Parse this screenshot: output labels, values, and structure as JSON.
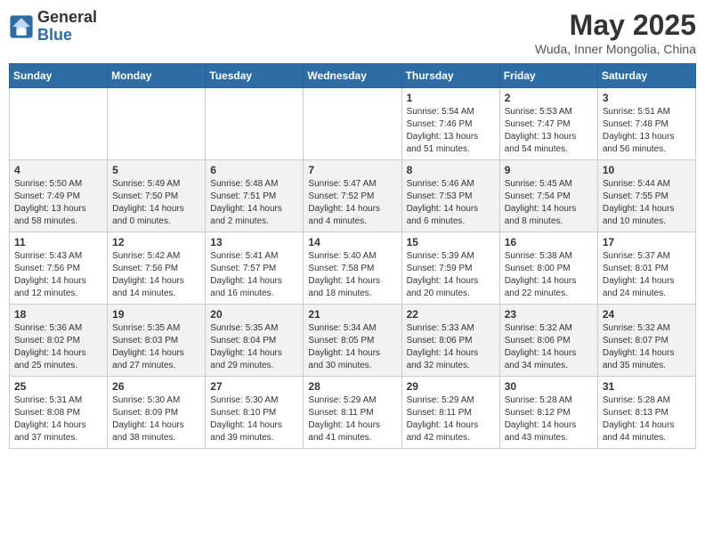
{
  "logo": {
    "general": "General",
    "blue": "Blue"
  },
  "title": "May 2025",
  "location": "Wuda, Inner Mongolia, China",
  "weekdays": [
    "Sunday",
    "Monday",
    "Tuesday",
    "Wednesday",
    "Thursday",
    "Friday",
    "Saturday"
  ],
  "weeks": [
    [
      {
        "day": "",
        "info": ""
      },
      {
        "day": "",
        "info": ""
      },
      {
        "day": "",
        "info": ""
      },
      {
        "day": "",
        "info": ""
      },
      {
        "day": "1",
        "info": "Sunrise: 5:54 AM\nSunset: 7:46 PM\nDaylight: 13 hours\nand 51 minutes."
      },
      {
        "day": "2",
        "info": "Sunrise: 5:53 AM\nSunset: 7:47 PM\nDaylight: 13 hours\nand 54 minutes."
      },
      {
        "day": "3",
        "info": "Sunrise: 5:51 AM\nSunset: 7:48 PM\nDaylight: 13 hours\nand 56 minutes."
      }
    ],
    [
      {
        "day": "4",
        "info": "Sunrise: 5:50 AM\nSunset: 7:49 PM\nDaylight: 13 hours\nand 58 minutes."
      },
      {
        "day": "5",
        "info": "Sunrise: 5:49 AM\nSunset: 7:50 PM\nDaylight: 14 hours\nand 0 minutes."
      },
      {
        "day": "6",
        "info": "Sunrise: 5:48 AM\nSunset: 7:51 PM\nDaylight: 14 hours\nand 2 minutes."
      },
      {
        "day": "7",
        "info": "Sunrise: 5:47 AM\nSunset: 7:52 PM\nDaylight: 14 hours\nand 4 minutes."
      },
      {
        "day": "8",
        "info": "Sunrise: 5:46 AM\nSunset: 7:53 PM\nDaylight: 14 hours\nand 6 minutes."
      },
      {
        "day": "9",
        "info": "Sunrise: 5:45 AM\nSunset: 7:54 PM\nDaylight: 14 hours\nand 8 minutes."
      },
      {
        "day": "10",
        "info": "Sunrise: 5:44 AM\nSunset: 7:55 PM\nDaylight: 14 hours\nand 10 minutes."
      }
    ],
    [
      {
        "day": "11",
        "info": "Sunrise: 5:43 AM\nSunset: 7:56 PM\nDaylight: 14 hours\nand 12 minutes."
      },
      {
        "day": "12",
        "info": "Sunrise: 5:42 AM\nSunset: 7:56 PM\nDaylight: 14 hours\nand 14 minutes."
      },
      {
        "day": "13",
        "info": "Sunrise: 5:41 AM\nSunset: 7:57 PM\nDaylight: 14 hours\nand 16 minutes."
      },
      {
        "day": "14",
        "info": "Sunrise: 5:40 AM\nSunset: 7:58 PM\nDaylight: 14 hours\nand 18 minutes."
      },
      {
        "day": "15",
        "info": "Sunrise: 5:39 AM\nSunset: 7:59 PM\nDaylight: 14 hours\nand 20 minutes."
      },
      {
        "day": "16",
        "info": "Sunrise: 5:38 AM\nSunset: 8:00 PM\nDaylight: 14 hours\nand 22 minutes."
      },
      {
        "day": "17",
        "info": "Sunrise: 5:37 AM\nSunset: 8:01 PM\nDaylight: 14 hours\nand 24 minutes."
      }
    ],
    [
      {
        "day": "18",
        "info": "Sunrise: 5:36 AM\nSunset: 8:02 PM\nDaylight: 14 hours\nand 25 minutes."
      },
      {
        "day": "19",
        "info": "Sunrise: 5:35 AM\nSunset: 8:03 PM\nDaylight: 14 hours\nand 27 minutes."
      },
      {
        "day": "20",
        "info": "Sunrise: 5:35 AM\nSunset: 8:04 PM\nDaylight: 14 hours\nand 29 minutes."
      },
      {
        "day": "21",
        "info": "Sunrise: 5:34 AM\nSunset: 8:05 PM\nDaylight: 14 hours\nand 30 minutes."
      },
      {
        "day": "22",
        "info": "Sunrise: 5:33 AM\nSunset: 8:06 PM\nDaylight: 14 hours\nand 32 minutes."
      },
      {
        "day": "23",
        "info": "Sunrise: 5:32 AM\nSunset: 8:06 PM\nDaylight: 14 hours\nand 34 minutes."
      },
      {
        "day": "24",
        "info": "Sunrise: 5:32 AM\nSunset: 8:07 PM\nDaylight: 14 hours\nand 35 minutes."
      }
    ],
    [
      {
        "day": "25",
        "info": "Sunrise: 5:31 AM\nSunset: 8:08 PM\nDaylight: 14 hours\nand 37 minutes."
      },
      {
        "day": "26",
        "info": "Sunrise: 5:30 AM\nSunset: 8:09 PM\nDaylight: 14 hours\nand 38 minutes."
      },
      {
        "day": "27",
        "info": "Sunrise: 5:30 AM\nSunset: 8:10 PM\nDaylight: 14 hours\nand 39 minutes."
      },
      {
        "day": "28",
        "info": "Sunrise: 5:29 AM\nSunset: 8:11 PM\nDaylight: 14 hours\nand 41 minutes."
      },
      {
        "day": "29",
        "info": "Sunrise: 5:29 AM\nSunset: 8:11 PM\nDaylight: 14 hours\nand 42 minutes."
      },
      {
        "day": "30",
        "info": "Sunrise: 5:28 AM\nSunset: 8:12 PM\nDaylight: 14 hours\nand 43 minutes."
      },
      {
        "day": "31",
        "info": "Sunrise: 5:28 AM\nSunset: 8:13 PM\nDaylight: 14 hours\nand 44 minutes."
      }
    ]
  ]
}
